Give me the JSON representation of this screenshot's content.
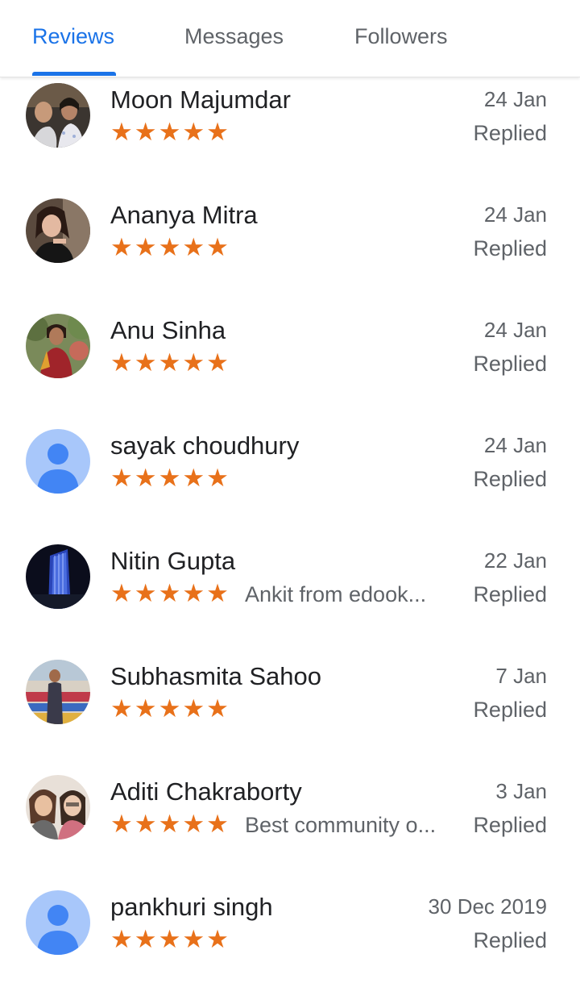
{
  "tabs": {
    "reviews": "Reviews",
    "messages": "Messages",
    "followers": "Followers",
    "active": "reviews"
  },
  "colors": {
    "accent": "#1a73e8",
    "star": "#e8711a",
    "text_primary": "#202124",
    "text_secondary": "#5f6368",
    "default_avatar_bg": "#a8c7fa",
    "default_avatar_fg": "#4285f4"
  },
  "reviews": [
    {
      "name": "Moon Majumdar",
      "stars": "★★★★★",
      "rating": 5,
      "snippet": "",
      "date": "24 Jan",
      "status": "Replied",
      "avatar": "photo"
    },
    {
      "name": "Ananya Mitra",
      "stars": "★★★★★",
      "rating": 5,
      "snippet": "",
      "date": "24 Jan",
      "status": "Replied",
      "avatar": "photo"
    },
    {
      "name": "Anu Sinha",
      "stars": "★★★★★",
      "rating": 5,
      "snippet": "",
      "date": "24 Jan",
      "status": "Replied",
      "avatar": "photo"
    },
    {
      "name": "sayak choudhury",
      "stars": "★★★★★",
      "rating": 5,
      "snippet": "",
      "date": "24 Jan",
      "status": "Replied",
      "avatar": "default-person-icon"
    },
    {
      "name": "Nitin Gupta",
      "stars": "★★★★★",
      "rating": 5,
      "snippet": "Ankit from edook...",
      "date": "22 Jan",
      "status": "Replied",
      "avatar": "photo"
    },
    {
      "name": "Subhasmita Sahoo",
      "stars": "★★★★★",
      "rating": 5,
      "snippet": "",
      "date": "7 Jan",
      "status": "Replied",
      "avatar": "photo"
    },
    {
      "name": "Aditi Chakraborty",
      "stars": "★★★★★",
      "rating": 5,
      "snippet": "Best community o...",
      "date": "3 Jan",
      "status": "Replied",
      "avatar": "photo"
    },
    {
      "name": "pankhuri singh",
      "stars": "★★★★★",
      "rating": 5,
      "snippet": "",
      "date": "30 Dec 2019",
      "status": "Replied",
      "avatar": "default-person-icon"
    }
  ]
}
